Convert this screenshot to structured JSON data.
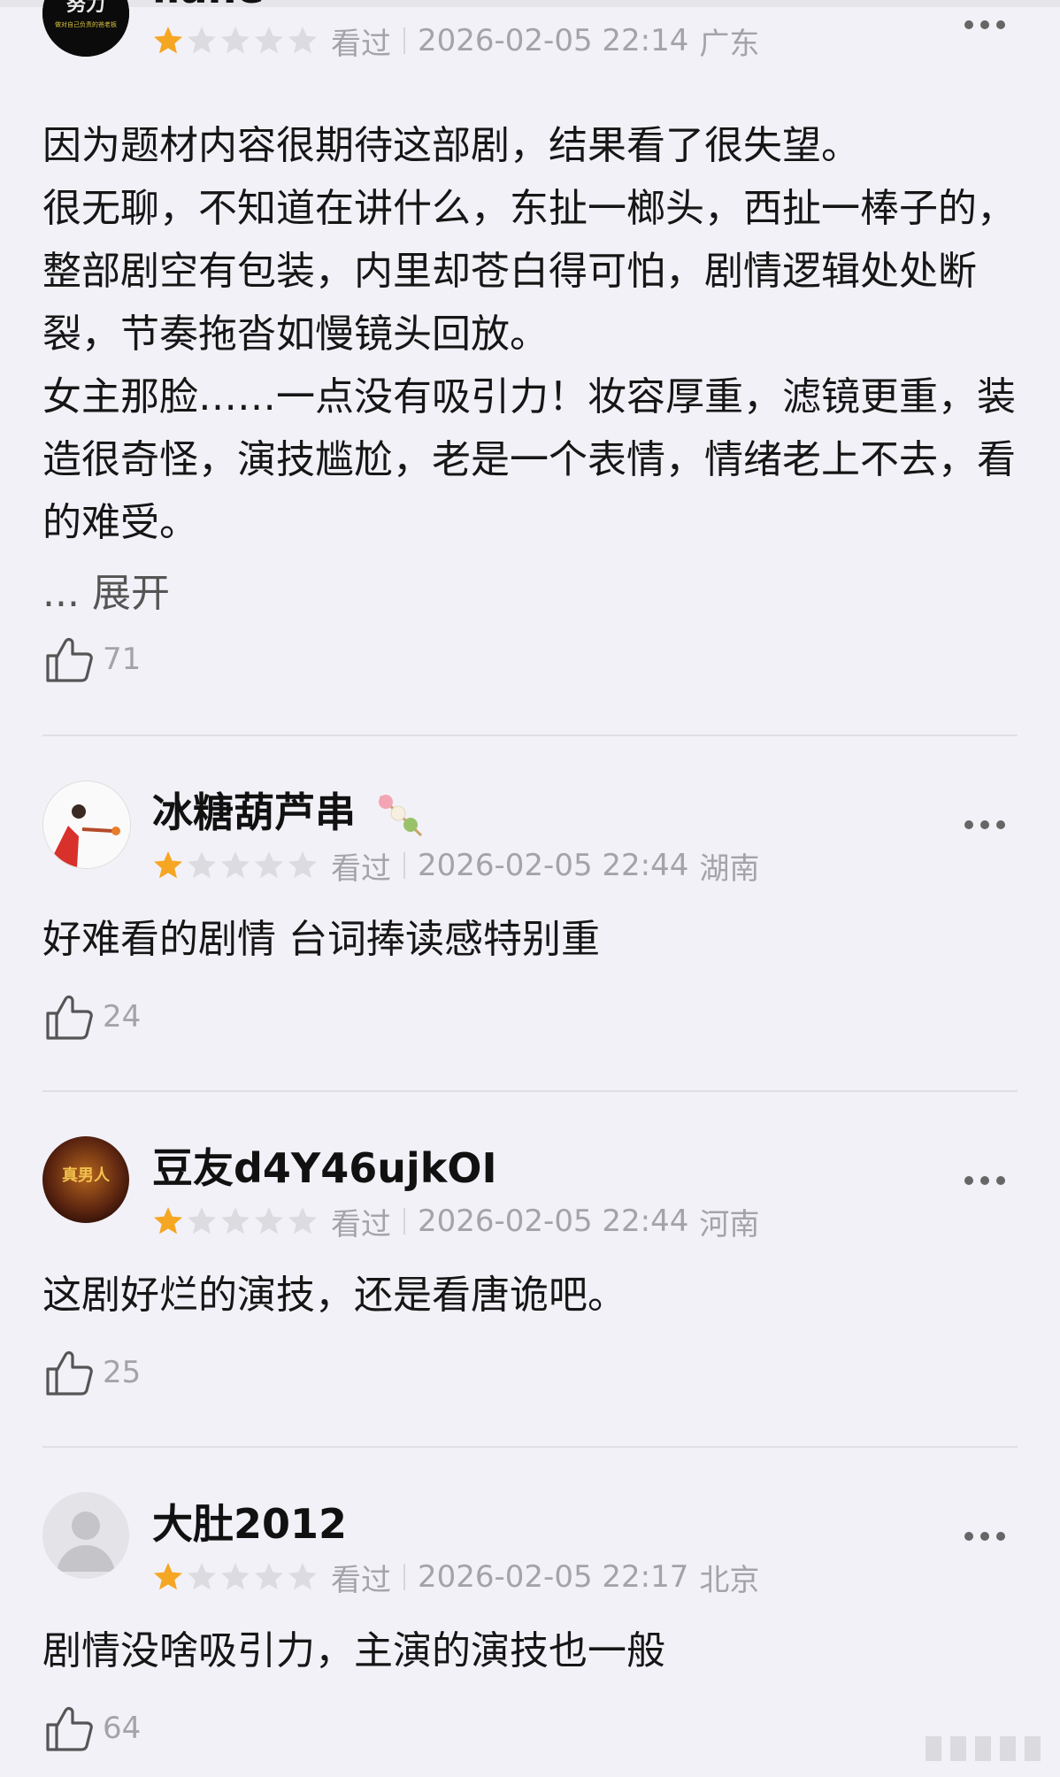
{
  "reviews": [
    {
      "username": "liane",
      "avatar_text": "努力",
      "avatar_subtext": "做对自己负责的爸老板",
      "rating": 1,
      "status": "看过",
      "datetime": "2026-02-05 22:14",
      "location": "广东",
      "content": "因为题材内容很期待这部剧，结果看了很失望。\n很无聊，不知道在讲什么，东扯一榔头，西扯一棒子的，整部剧空有包装，内里却苍白得可怕，剧情逻辑处处断裂，节奏拖沓如慢镜头回放。\n女主那脸……一点没有吸引力！妆容厚重，滤镜更重，装造很奇怪，演技尴尬，老是一个表情，情绪老上不去，看的难受。",
      "expand_label": "... 展开",
      "likes": "71"
    },
    {
      "username": "冰糖葫芦串",
      "rating": 1,
      "status": "看过",
      "datetime": "2026-02-05 22:44",
      "location": "湖南",
      "content": "好难看的剧情 台词捧读感特别重",
      "likes": "24"
    },
    {
      "username": "豆友d4Y46ujkOI",
      "avatar_text": "真男人",
      "rating": 1,
      "status": "看过",
      "datetime": "2026-02-05 22:44",
      "location": "河南",
      "content": "这剧好烂的演技，还是看唐诡吧。",
      "likes": "25"
    },
    {
      "username": "大肚2012",
      "rating": 1,
      "status": "看过",
      "datetime": "2026-02-05 22:17",
      "location": "北京",
      "content": "剧情没啥吸引力，主演的演技也一般",
      "likes": "64"
    }
  ],
  "colors": {
    "background": "#f2f1f7",
    "star_filled": "#f5a623",
    "star_empty": "#dcdce0",
    "meta_text": "#a3a3a8"
  }
}
